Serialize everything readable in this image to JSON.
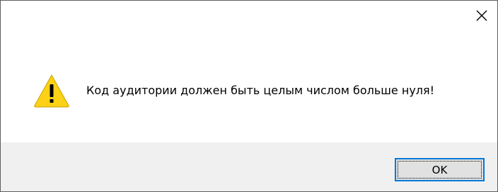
{
  "dialog": {
    "message": "Код аудитории должен быть целым числом больше нуля!",
    "icon": "warning-icon",
    "close_glyph": "close-icon"
  },
  "buttons": {
    "ok_label": "OK"
  },
  "colors": {
    "warning_fill": "#fcd116",
    "button_border": "#0078d7",
    "footer_bg": "#f0f0f0"
  }
}
